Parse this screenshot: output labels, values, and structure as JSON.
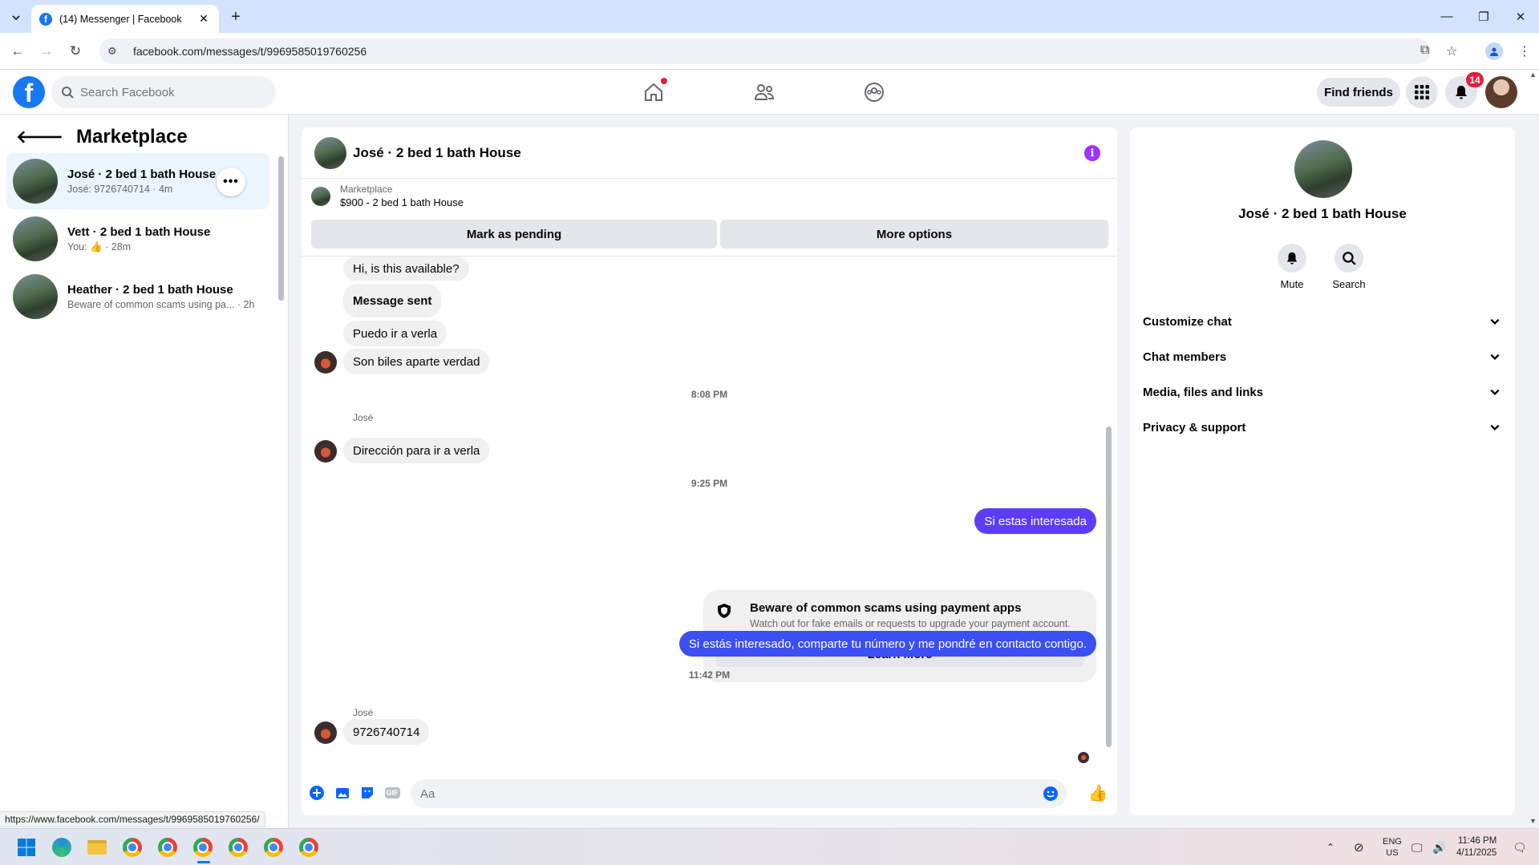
{
  "browser": {
    "tab_title": "(14) Messenger | Facebook",
    "url": "facebook.com/messages/t/9969585019760256",
    "status_url": "https://www.facebook.com/messages/t/9969585019760256/"
  },
  "header": {
    "search_placeholder": "Search Facebook",
    "find_friends": "Find friends",
    "notification_count": "14"
  },
  "left": {
    "title": "Marketplace",
    "conversations": [
      {
        "name": "José · 2 bed 1 bath House",
        "sub": "José: 9726740714 · 4m"
      },
      {
        "name": "Vett · 2 bed 1 bath House",
        "sub_prefix": "You:",
        "sub_suffix": "· 28m"
      },
      {
        "name": "Heather · 2 bed 1 bath House",
        "sub": "Beware of common scams using pa... · 2h"
      }
    ]
  },
  "chat": {
    "title": "José · 2 bed 1 bath House",
    "listing_label": "Marketplace",
    "listing_price": "$900 - 2 bed 1 bath House",
    "mark_pending": "Mark as pending",
    "more_options": "More options",
    "messages": {
      "m1": "Hi, is this available?",
      "m2": "Message sent",
      "m3": "Puedo ir a verla",
      "m4": "Son biles aparte verdad",
      "t1": "8:08 PM",
      "sender1": "José",
      "m5": "Dirección para ir a verla",
      "t2": "9:25 PM",
      "m6": "Si estas interesada",
      "warn_title": "Beware of common scams using payment apps",
      "warn_sub": "Watch out for fake emails or requests to upgrade your payment account.",
      "learn_more": "Learn More",
      "m7": "Si estás interesado, comparte tu número y me pondré en contacto contigo.",
      "t3": "11:42 PM",
      "sender2": "José",
      "m8": "9726740714"
    },
    "composer_placeholder": "Aa"
  },
  "right": {
    "name": "José · 2 bed 1 bath House",
    "mute": "Mute",
    "search": "Search",
    "sections": [
      "Customize chat",
      "Chat members",
      "Media, files and links",
      "Privacy & support"
    ]
  },
  "taskbar": {
    "lang_top": "ENG",
    "lang_bottom": "US",
    "time": "11:46 PM",
    "date": "4/11/2025"
  },
  "colors": {
    "fb_blue": "#1877f2",
    "outgoing_bubble": "#5b3df5",
    "outgoing_bubble_2": "#3b4ff2",
    "info_purple": "#a033ff",
    "badge_red": "#e41e3f"
  }
}
